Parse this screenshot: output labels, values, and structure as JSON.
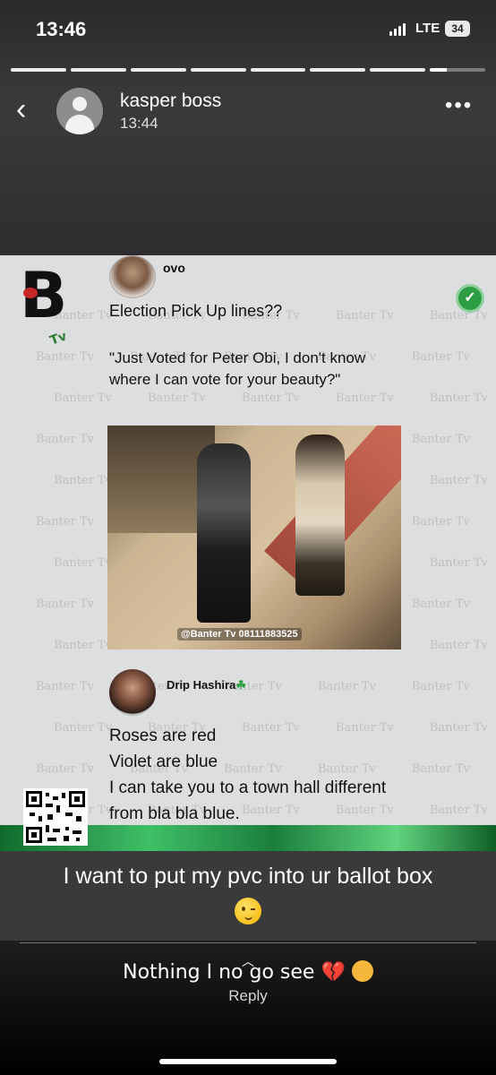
{
  "status_bar": {
    "time": "13:46",
    "network": "LTE",
    "battery": "34"
  },
  "story": {
    "segments": 8,
    "current_segment": 8,
    "current_segment_progress": 0.3
  },
  "header": {
    "username": "kasper boss",
    "time": "13:44"
  },
  "post": {
    "poster_name": "ovo",
    "heading": "Election Pick Up lines??",
    "quote": "\"Just Voted for Peter Obi, I don't know where I can vote for your beauty?\"",
    "photo_caption": "@Banter Tv  08111883525",
    "watermark": "Banter Tv",
    "commenter_name": "Drip Hashira",
    "comment_lines": [
      "Roses are red",
      "Violet are blue",
      "I can take you to a town hall different",
      "from bla bla blue."
    ]
  },
  "caption": {
    "text": "I want to put my pvc into ur ballot box"
  },
  "reply": {
    "text": "Nothing I no go see",
    "label": "Reply"
  },
  "colors": {
    "verified": "#2e9e44",
    "heart": "#d81b37",
    "strip": "#3fbf67"
  }
}
